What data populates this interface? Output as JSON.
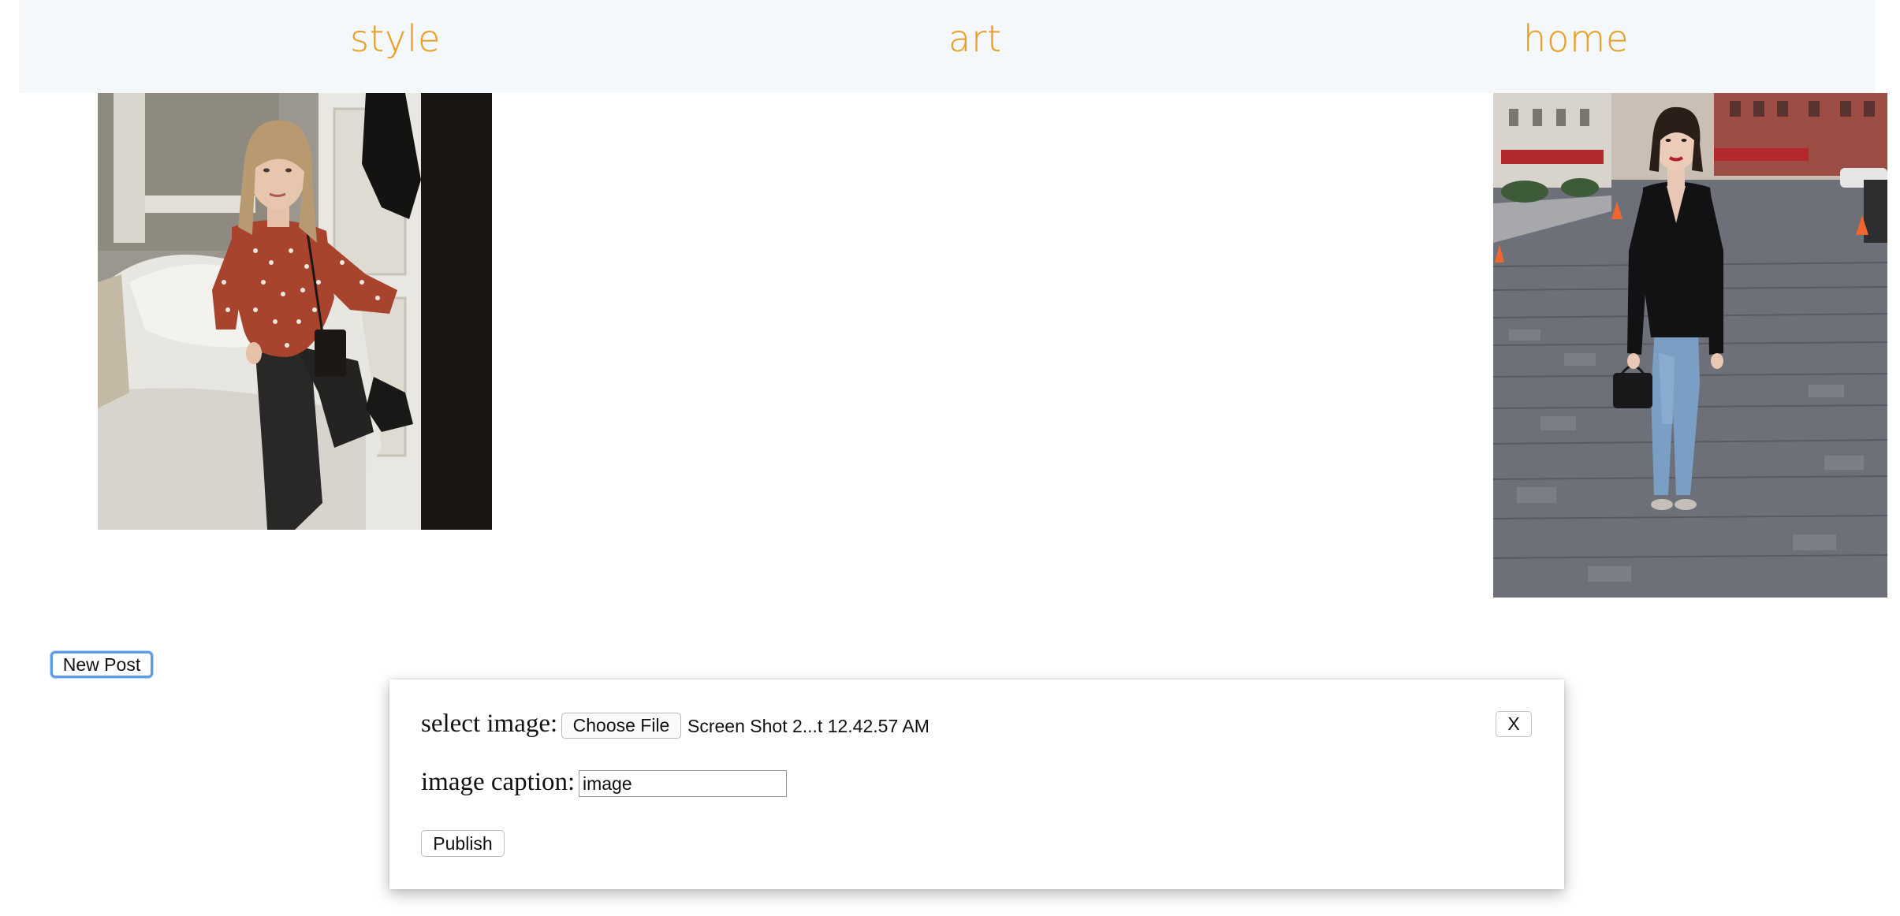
{
  "nav": {
    "items": [
      {
        "label": "style"
      },
      {
        "label": "art"
      },
      {
        "label": "home"
      }
    ],
    "color": "#e8a02a",
    "background": "#f4f8fa"
  },
  "posts": [
    {
      "image": "woman-red-polka-dot-blouse-photo"
    },
    {
      "image": "woman-black-shirt-jeans-street-photo"
    }
  ],
  "new_post_button": {
    "label": "New Post"
  },
  "modal": {
    "select_image_label": "select image:",
    "choose_file_label": "Choose File",
    "file_name": "Screen Shot 2...t 12.42.57 AM",
    "close_label": "X",
    "caption_label": "image caption:",
    "caption_value": "image",
    "publish_label": "Publish"
  }
}
